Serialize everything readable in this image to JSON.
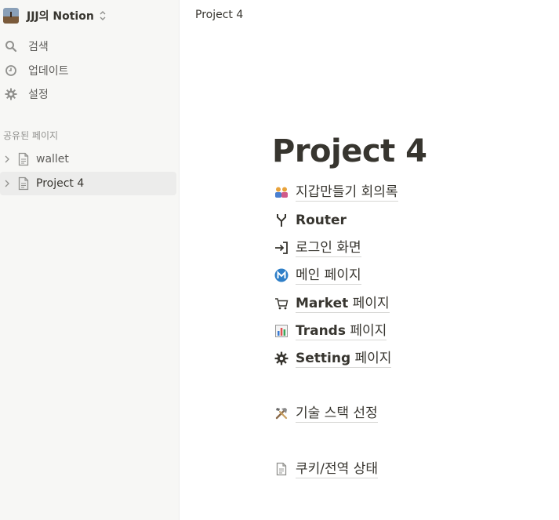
{
  "workspace": {
    "name": "JJJ의 Notion"
  },
  "nav": [
    {
      "label": "검색",
      "icon": "search-icon"
    },
    {
      "label": "업데이트",
      "icon": "clock-icon"
    },
    {
      "label": "설정",
      "icon": "gear-icon"
    }
  ],
  "section": {
    "label": "공유된 페이지"
  },
  "tree": [
    {
      "label": "wallet",
      "active": false
    },
    {
      "label": "Project 4",
      "active": true
    }
  ],
  "topbar": {
    "title": "Project 4"
  },
  "page": {
    "title": "Project 4",
    "links": [
      {
        "label": "지갑만들기 회의록",
        "icon": "people-emoji-icon"
      },
      {
        "label": "Router",
        "icon": "fork-icon"
      },
      {
        "label": "로그인 화면",
        "icon": "login-arrow-icon"
      },
      {
        "label": "메인 페이지",
        "icon": "m-circle-icon"
      },
      {
        "label": "Market",
        "suffix": " 페이지",
        "icon": "cart-icon"
      },
      {
        "label": "Trands",
        "suffix": " 페이지",
        "icon": "bar-chart-icon"
      },
      {
        "label": "Setting",
        "suffix": " 페이지",
        "icon": "gear-icon"
      },
      {
        "label": "기술 스택 선정",
        "icon": "tools-icon"
      },
      {
        "label": "쿠키/전역 상태",
        "icon": "page-icon"
      }
    ]
  }
}
